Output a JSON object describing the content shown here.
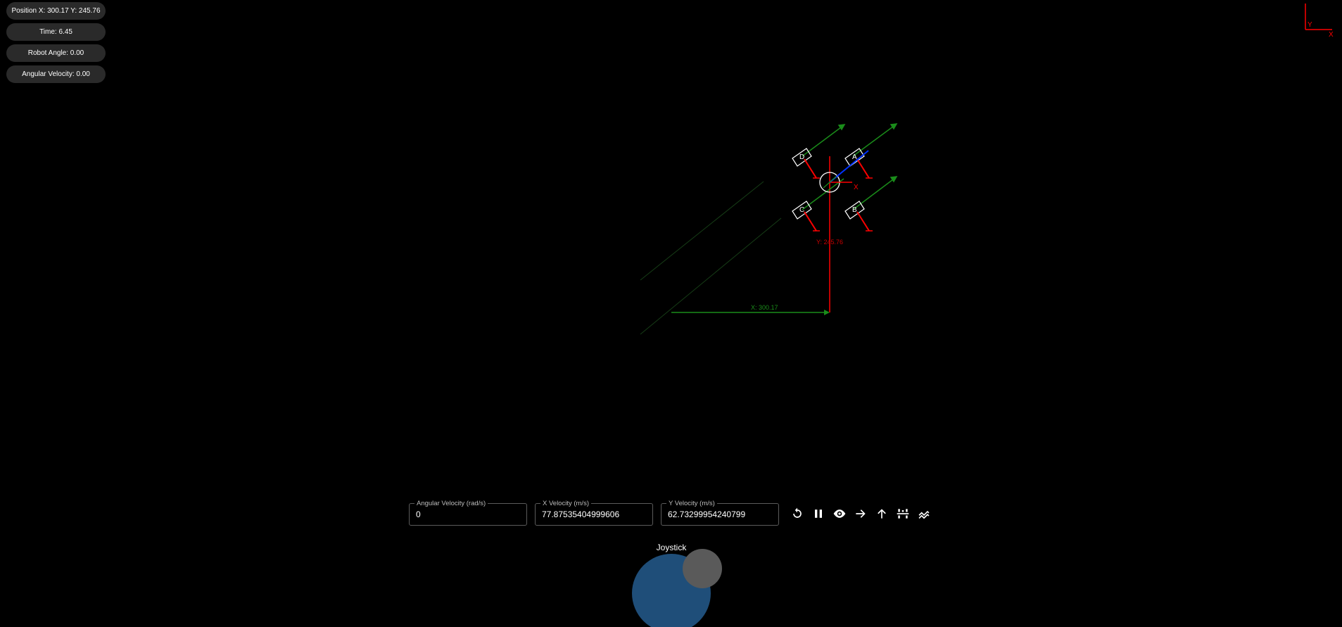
{
  "hud": {
    "position": "Position X: 300.17 Y: 245.76",
    "time": "Time: 6.45",
    "robot_angle": "Robot Angle: 0.00",
    "angular_velocity": "Angular Velocity: 0.00"
  },
  "axes_indicator": {
    "y_label": "Y",
    "x_label": "X",
    "color": "#ff0000"
  },
  "scene": {
    "x_readout": "X: 300.17",
    "y_readout": "Y: 245.76",
    "robot_axis_x_label": "X",
    "wheel_labels": [
      "D",
      "A",
      "C",
      "B"
    ],
    "colors": {
      "path": "#1f6b1f",
      "frame": "#ff0000",
      "robot": "#ffffff",
      "velocity": "#0033ff",
      "wheel_vector": "#1a8c1a"
    }
  },
  "controls": {
    "angular_velocity": {
      "label": "Angular Velocity (rad/s)",
      "value": "0"
    },
    "x_velocity": {
      "label": "X Velocity (m/s)",
      "value": "77.87535404999606"
    },
    "y_velocity": {
      "label": "Y Velocity (m/s)",
      "value": "62.73299954240799"
    },
    "buttons": [
      {
        "icon": "reset-icon"
      },
      {
        "icon": "pause-icon"
      },
      {
        "icon": "eye-icon"
      },
      {
        "icon": "arrow-right-icon"
      },
      {
        "icon": "arrow-up-icon"
      },
      {
        "icon": "wheels-icon"
      },
      {
        "icon": "trail-icon"
      }
    ]
  },
  "joystick": {
    "title": "Joystick",
    "base_color": "#1f4e79",
    "knob_color": "#5a5a5a"
  }
}
